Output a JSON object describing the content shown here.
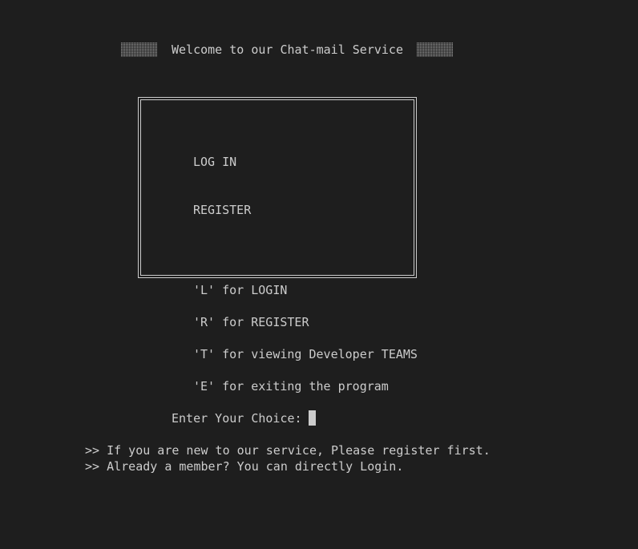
{
  "header": {
    "title": "Welcome to our Chat-mail Service"
  },
  "menu": {
    "items": [
      {
        "label": "LOG IN"
      },
      {
        "label": "REGISTER"
      }
    ]
  },
  "options": [
    {
      "text": "'L' for LOGIN"
    },
    {
      "text": "'R' for REGISTER"
    },
    {
      "text": "'T' for viewing Developer TEAMS"
    },
    {
      "text": "'E' for exiting the program"
    }
  ],
  "prompt": {
    "label": "Enter Your Choice:",
    "value": ""
  },
  "messages": [
    {
      "text": ">> If you are new to our service, Please register first."
    },
    {
      "text": ">> Already a member? You can directly Login."
    }
  ]
}
